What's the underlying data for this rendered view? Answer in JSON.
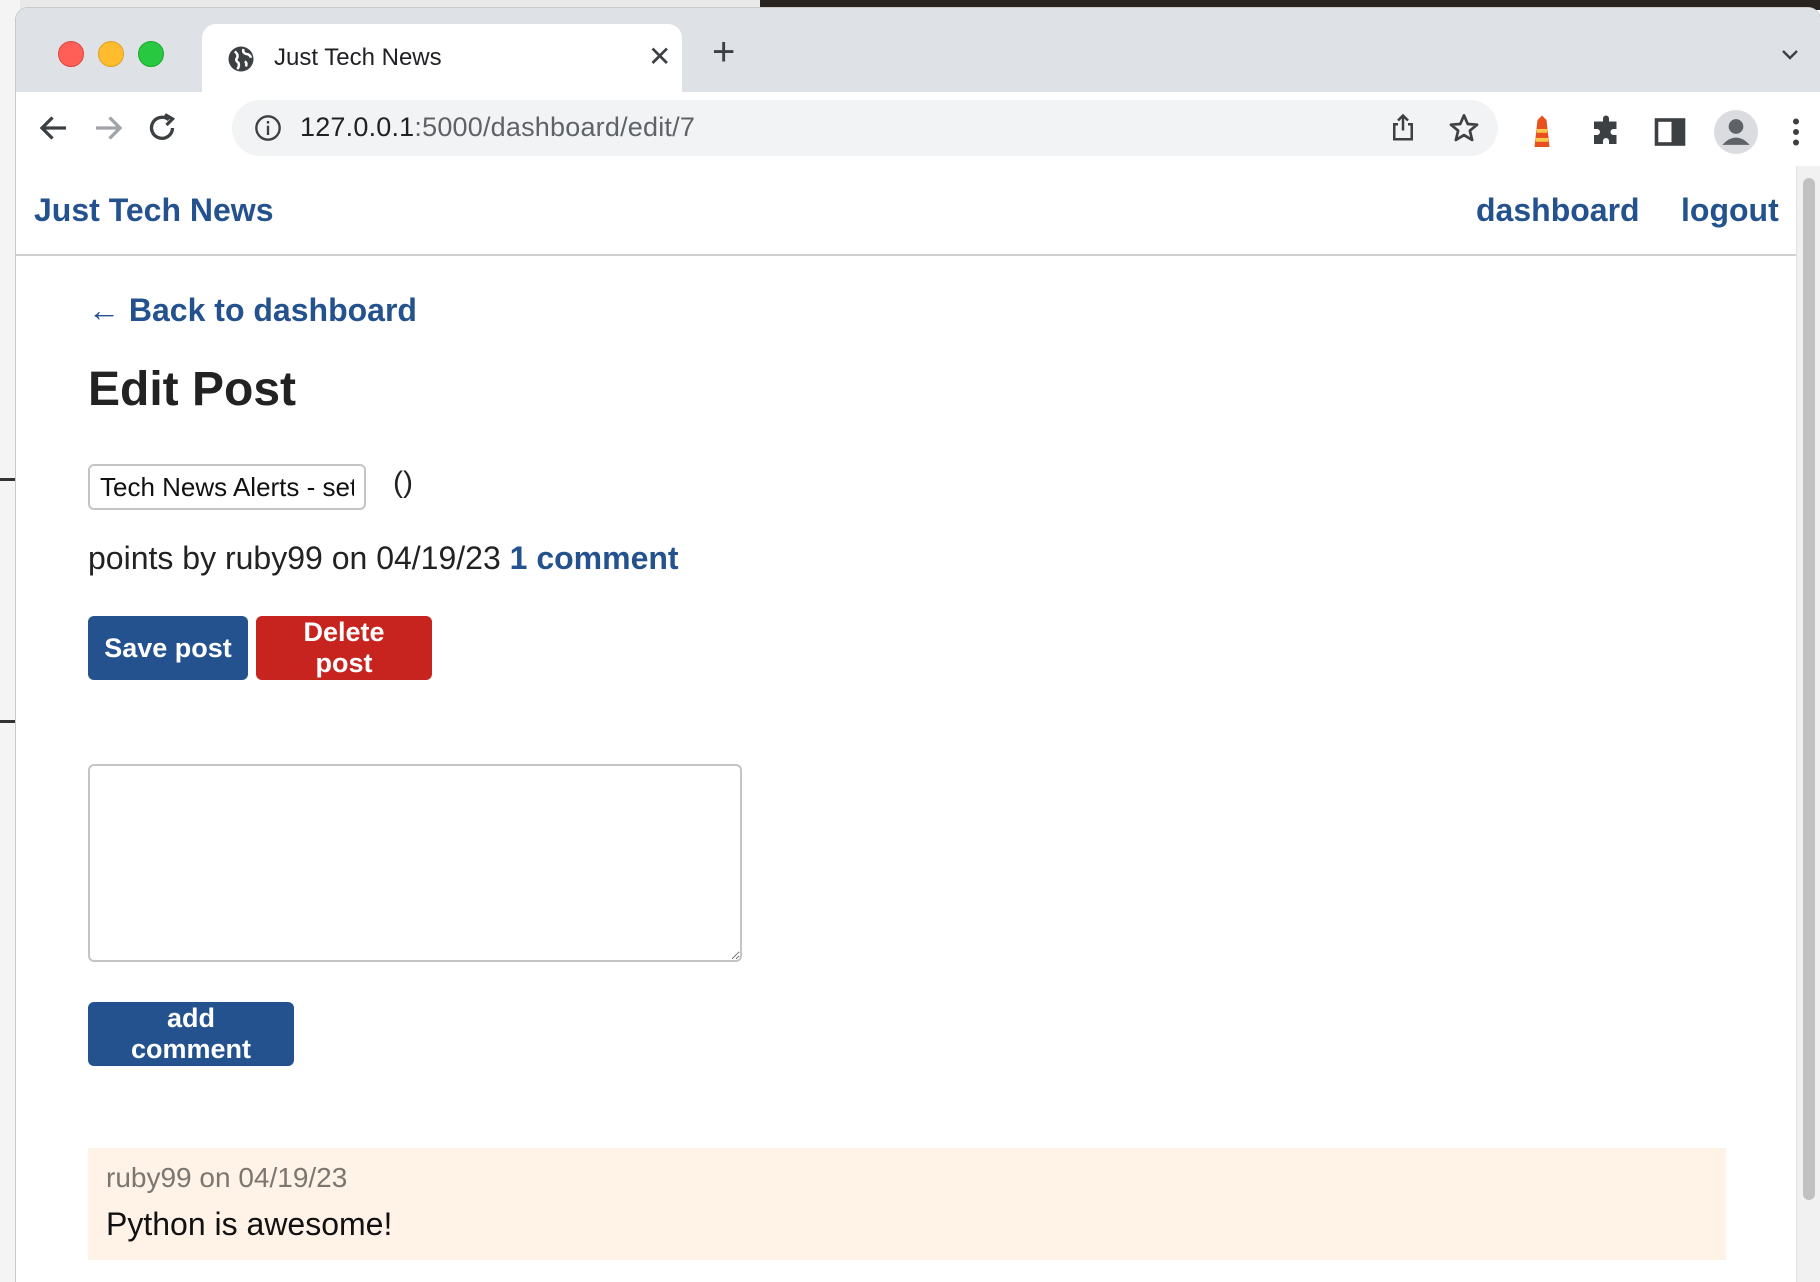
{
  "browser": {
    "tab_title": "Just Tech News",
    "tab_close": "✕",
    "new_tab": "+",
    "url_host": "127.0.0.1",
    "url_rest": ":5000/dashboard/edit/7"
  },
  "site": {
    "brand": "Just Tech News",
    "nav": {
      "dashboard": "dashboard",
      "logout": "logout"
    }
  },
  "main": {
    "back_link": "← Back to dashboard",
    "heading": "Edit Post",
    "title_input_value": "Tech News Alerts - set up",
    "title_paren": "()",
    "meta_text": "points by ruby99 on 04/19/23 ",
    "comments_link": "1 comment",
    "save_label": "Save post",
    "delete_label": "Delete post",
    "comment_placeholder": "",
    "add_comment_label": "add comment"
  },
  "comments": [
    {
      "meta": "ruby99 on 04/19/23",
      "text": "Python is awesome!"
    }
  ],
  "colors": {
    "brand_blue": "#24528e",
    "danger_red": "#c7231f",
    "comment_bg": "#fff3e8"
  }
}
